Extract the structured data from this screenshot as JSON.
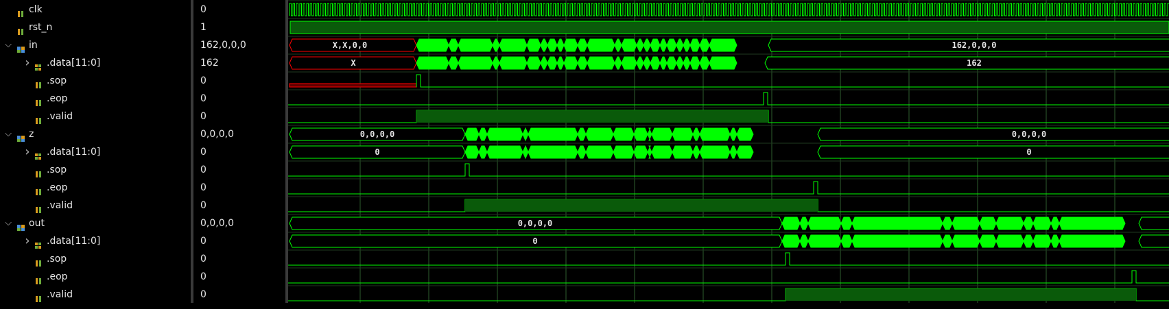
{
  "signals": [
    {
      "id": "clk",
      "name": "clk",
      "value": "0",
      "indent": 1,
      "expand": "",
      "icon": "wire"
    },
    {
      "id": "rst_n",
      "name": "rst_n",
      "value": "1",
      "indent": 1,
      "expand": "",
      "icon": "wire"
    },
    {
      "id": "in",
      "name": "in",
      "value": "162,0,0,0",
      "indent": 0,
      "expand": "v",
      "icon": "struct"
    },
    {
      "id": "in_data",
      "name": ".data[11:0]",
      "value": "162",
      "indent": 1,
      "expand": ">",
      "icon": "bus"
    },
    {
      "id": "in_sop",
      "name": ".sop",
      "value": "0",
      "indent": 2,
      "expand": "",
      "icon": "wire"
    },
    {
      "id": "in_eop",
      "name": ".eop",
      "value": "0",
      "indent": 2,
      "expand": "",
      "icon": "wire"
    },
    {
      "id": "in_valid",
      "name": ".valid",
      "value": "0",
      "indent": 2,
      "expand": "",
      "icon": "wire"
    },
    {
      "id": "z",
      "name": "z",
      "value": "0,0,0,0",
      "indent": 0,
      "expand": "v",
      "icon": "struct"
    },
    {
      "id": "z_data",
      "name": ".data[11:0]",
      "value": "0",
      "indent": 1,
      "expand": ">",
      "icon": "bus"
    },
    {
      "id": "z_sop",
      "name": ".sop",
      "value": "0",
      "indent": 2,
      "expand": "",
      "icon": "wire"
    },
    {
      "id": "z_eop",
      "name": ".eop",
      "value": "0",
      "indent": 2,
      "expand": "",
      "icon": "wire"
    },
    {
      "id": "z_valid",
      "name": ".valid",
      "value": "0",
      "indent": 2,
      "expand": "",
      "icon": "wire"
    },
    {
      "id": "out",
      "name": "out",
      "value": "0,0,0,0",
      "indent": 0,
      "expand": "v",
      "icon": "struct"
    },
    {
      "id": "out_data",
      "name": ".data[11:0]",
      "value": "0",
      "indent": 1,
      "expand": ">",
      "icon": "bus"
    },
    {
      "id": "out_sop",
      "name": ".sop",
      "value": "0",
      "indent": 2,
      "expand": "",
      "icon": "wire"
    },
    {
      "id": "out_eop",
      "name": ".eop",
      "value": "0",
      "indent": 2,
      "expand": "",
      "icon": "wire"
    },
    {
      "id": "out_valid",
      "name": ".valid",
      "value": "0",
      "indent": 2,
      "expand": "",
      "icon": "wire"
    }
  ],
  "waves": {
    "in_label_start": "X,X,0,0",
    "in_label_end": "162,0,0,0",
    "in_data_label_start": "X",
    "in_data_label_end": "162",
    "z_label_start": "0,0,0,0",
    "z_label_end": "0,0,0,0",
    "z_data_label_start": "0",
    "z_data_label_end": "0",
    "out_label_start": "0,0,0,0",
    "out_data_label_start": "0"
  },
  "colors": {
    "wave": "#00ff00",
    "wave_fill": "#0a5a0a",
    "unknown": "#ff0000",
    "unknown_fill": "#600000",
    "grid": "#2e5e2e",
    "text": "#e6e6e6"
  }
}
